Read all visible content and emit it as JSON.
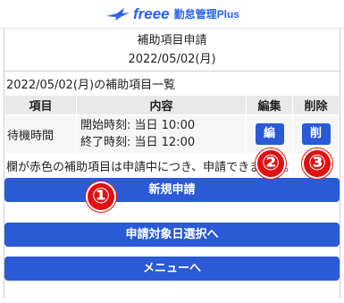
{
  "header": {
    "logo_brand": "freee",
    "logo_product": "勤怠管理Plus"
  },
  "page": {
    "title": "補助項目申請",
    "date": "2022/05/02(月)"
  },
  "list": {
    "caption": "2022/05/02(月)の補助項目一覧",
    "columns": [
      "項目",
      "内容",
      "編集",
      "削除"
    ],
    "rows": [
      {
        "name": "待機時間",
        "start": "開始時刻: 当日 10:00",
        "end": "終了時刻: 当日 12:00",
        "edit_label": "編",
        "delete_label": "削"
      }
    ]
  },
  "note": "欄が赤色の補助項目は申請中につき、申請できません。",
  "buttons": {
    "new_request": "新規申請",
    "select_date": "申請対象日選択へ",
    "menu": "メニューへ"
  },
  "annotations": [
    "①",
    "②",
    "③"
  ],
  "colors": {
    "brand": "#2864f0",
    "button": "#2a5ad6",
    "badge": "#e21010"
  }
}
